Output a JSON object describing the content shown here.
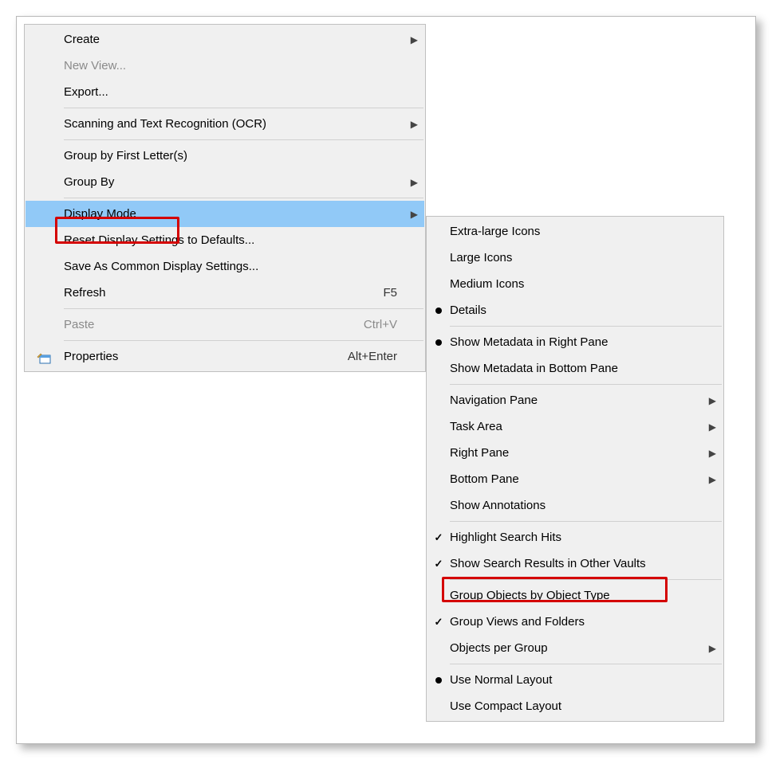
{
  "main_menu": {
    "create": "Create",
    "new_view": "New View...",
    "export": "Export...",
    "scan_ocr": "Scanning and Text Recognition (OCR)",
    "group_first": "Group by First Letter(s)",
    "group_by": "Group By",
    "display_mode": "Display Mode",
    "reset_display": "Reset Display Settings to Defaults...",
    "save_common": "Save As Common Display Settings...",
    "refresh": "Refresh",
    "refresh_accel": "F5",
    "paste": "Paste",
    "paste_accel": "Ctrl+V",
    "properties": "Properties",
    "properties_accel": "Alt+Enter"
  },
  "sub_menu": {
    "xl_icons": "Extra-large Icons",
    "lg_icons": "Large Icons",
    "md_icons": "Medium Icons",
    "details": "Details",
    "meta_right": "Show Metadata in Right Pane",
    "meta_bottom": "Show Metadata in Bottom Pane",
    "nav_pane": "Navigation Pane",
    "task_area": "Task Area",
    "right_pane": "Right Pane",
    "bottom_pane": "Bottom Pane",
    "show_anno": "Show Annotations",
    "hl_search": "Highlight Search Hits",
    "show_other_vaults": "Show Search Results in Other Vaults",
    "group_obj_type": "Group Objects by Object Type",
    "group_views": "Group Views and Folders",
    "obj_per_group": "Objects per Group",
    "normal_layout": "Use Normal Layout",
    "compact_layout": "Use Compact Layout"
  }
}
